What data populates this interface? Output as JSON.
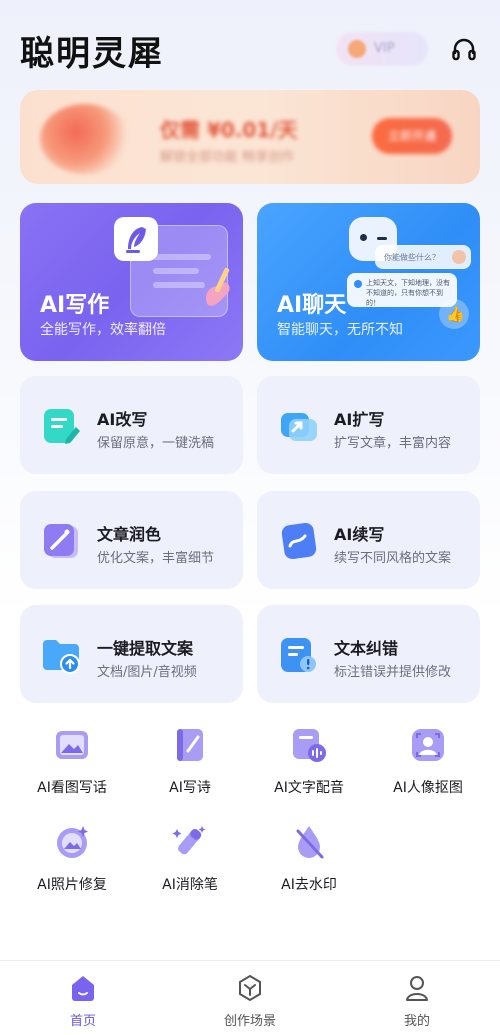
{
  "header": {
    "app_title": "聪明灵犀",
    "vip_label": "VIP"
  },
  "banner": {
    "price_text": "仅需 ¥0.01/天",
    "sub_text": "解锁全部功能 畅享创作",
    "cta_label": "立即开通"
  },
  "hero_cards": [
    {
      "title": "AI写作",
      "subtitle": "全能写作，效率翻倍"
    },
    {
      "title": "AI聊天",
      "subtitle": "智能聊天，无所不知",
      "bubble1": "你能做些什么？",
      "bubble2": "上知天文，下知地理，没有不知道的，只有你想不到的！"
    }
  ],
  "feature_cards": [
    {
      "title": "AI改写",
      "subtitle": "保留原意，一键洗稿",
      "icon": "edit-doc-icon"
    },
    {
      "title": "AI扩写",
      "subtitle": "扩写文章，丰富内容",
      "icon": "expand-link-icon"
    },
    {
      "title": "文章润色",
      "subtitle": "优化文案，丰富细节",
      "icon": "magic-wand-icon"
    },
    {
      "title": "AI续写",
      "subtitle": "续写不同风格的文案",
      "icon": "continue-write-icon"
    },
    {
      "title": "一键提取文案",
      "subtitle": "文档/图片/音视频",
      "icon": "folder-upload-icon"
    },
    {
      "title": "文本纠错",
      "subtitle": "标注错误并提供修改",
      "icon": "proofread-icon"
    }
  ],
  "tools": [
    {
      "label": "AI看图写话",
      "icon": "picture-write-icon"
    },
    {
      "label": "AI写诗",
      "icon": "poem-book-icon"
    },
    {
      "label": "AI文字配音",
      "icon": "voice-dub-icon"
    },
    {
      "label": "AI人像抠图",
      "icon": "portrait-cutout-icon"
    },
    {
      "label": "AI照片修复",
      "icon": "photo-restore-icon"
    },
    {
      "label": "AI消除笔",
      "icon": "eraser-pen-icon"
    },
    {
      "label": "AI去水印",
      "icon": "watermark-remove-icon"
    }
  ],
  "tabbar": [
    {
      "label": "首页",
      "active": true
    },
    {
      "label": "创作场景",
      "active": false
    },
    {
      "label": "我的",
      "active": false
    }
  ],
  "colors": {
    "accent_purple": "#7a63ef",
    "accent_blue": "#2f8ef7",
    "card_bg": "#eef0fb",
    "banner_orange": "#fb6b3e"
  }
}
